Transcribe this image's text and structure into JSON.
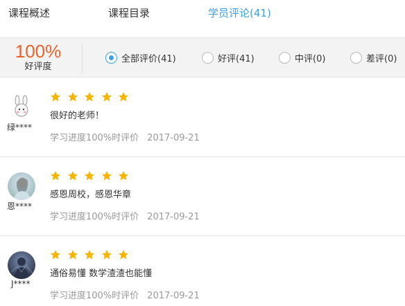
{
  "tabs": [
    {
      "label": "课程概述"
    },
    {
      "label": "课程目录"
    },
    {
      "label": "学员评论(41)"
    }
  ],
  "summary": {
    "rate_value": "100%",
    "rate_label": "好评度"
  },
  "filters": [
    {
      "label": "全部评价(41)",
      "checked": true
    },
    {
      "label": "好评(41)",
      "checked": false
    },
    {
      "label": "中评(0)",
      "checked": false
    },
    {
      "label": "差评(0)",
      "checked": false
    }
  ],
  "reviews": [
    {
      "user": "绿****",
      "rating": 5,
      "comment": "很好的老师！",
      "progress": "学习进度100%时评价",
      "date": "2017-09-21"
    },
    {
      "user": "恩****",
      "rating": 5,
      "comment": "感恩周校，感恩华章",
      "progress": "学习进度100%时评价",
      "date": "2017-09-21"
    },
    {
      "user": "J****",
      "rating": 5,
      "comment": "通俗易懂 数学渣渣也能懂",
      "progress": "学习进度100%时评价",
      "date": "2017-09-21"
    }
  ],
  "colors": {
    "accent": "#3ba1e1",
    "rate": "#e8622a",
    "star": "#f5b400"
  }
}
